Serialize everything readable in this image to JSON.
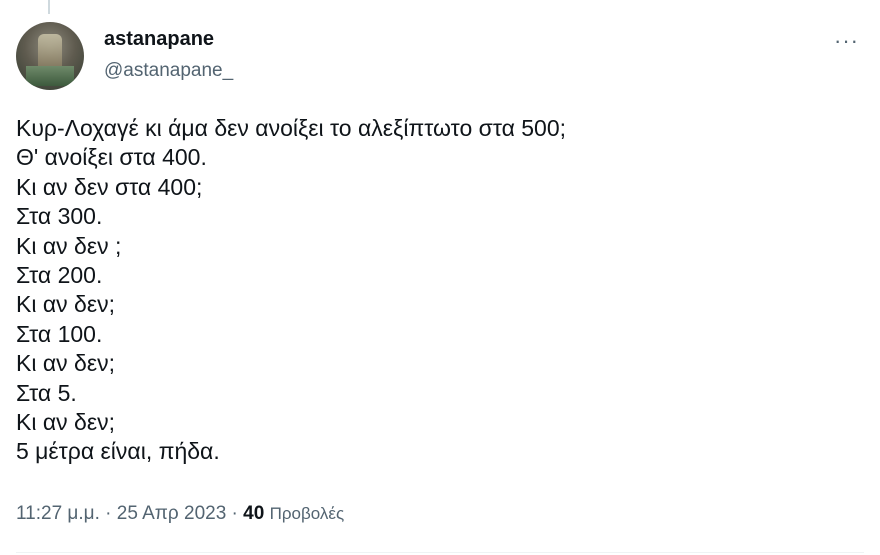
{
  "tweet": {
    "display_name": "astanapane",
    "handle": "@astanapane_",
    "more_label": "···",
    "lines": [
      "Κυρ-Λοχαγέ κι άμα δεν ανοίξει το αλεξίπτωτο στα 500;",
      "Θ' ανοίξει στα 400.",
      "Κι αν δεν στα 400;",
      "Στα 300.",
      "Κι αν δεν ;",
      "Στα 200.",
      "Κι αν δεν;",
      "Στα 100.",
      "Κι αν δεν;",
      "Στα 5.",
      "Κι αν δεν;",
      "5 μέτρα είναι, πήδα."
    ],
    "time": "11:27 μ.μ.",
    "separator": " · ",
    "date": "25 Απρ 2023",
    "views_count": "40",
    "views_label": "Προβολές"
  },
  "colors": {
    "text": "#0f1419",
    "secondary": "#536471",
    "divider": "#eff3f4"
  },
  "icons": {
    "more": "more-horizontal-icon"
  }
}
